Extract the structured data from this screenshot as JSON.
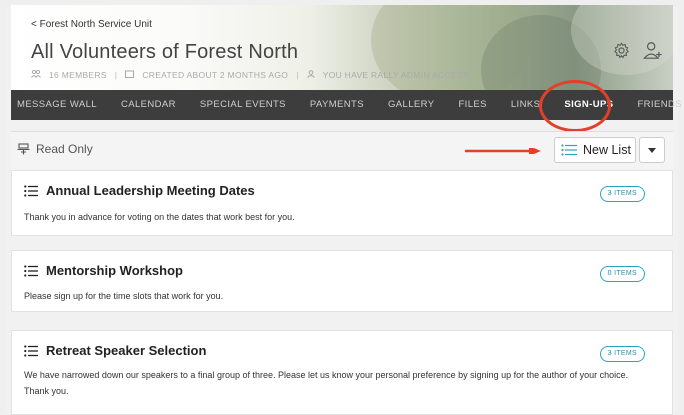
{
  "header": {
    "breadcrumb": "< Forest North Service Unit",
    "title": "All Volunteers of Forest North",
    "meta": {
      "members": "16 MEMBERS",
      "created": "CREATED ABOUT 2 MONTHS AGO",
      "access": "YOU HAVE RALLY ADMIN ACCESS"
    }
  },
  "nav": {
    "tabs": [
      {
        "label": "MESSAGE WALL"
      },
      {
        "label": "CALENDAR"
      },
      {
        "label": "SPECIAL EVENTS"
      },
      {
        "label": "PAYMENTS"
      },
      {
        "label": "GALLERY"
      },
      {
        "label": "FILES"
      },
      {
        "label": "LINKS"
      },
      {
        "label": "SIGN-UPS"
      },
      {
        "label": "FRIENDS"
      }
    ],
    "active": "SIGN-UPS"
  },
  "toolbar": {
    "readonly_label": "Read Only",
    "new_list_label": "New List"
  },
  "lists": [
    {
      "title": "Annual Leadership Meeting Dates",
      "badge": "3 ITEMS",
      "description": "Thank you in advance for voting on the dates that work best for you."
    },
    {
      "title": "Mentorship Workshop",
      "badge": "0 ITEMS",
      "description": "Please sign up for the time slots that work for you."
    },
    {
      "title": "Retreat Speaker Selection",
      "badge": "3 ITEMS",
      "description": "We have narrowed down our speakers to a final group of three. Please let us know your personal preference by signing up for the author of your choice. Thank you."
    }
  ],
  "colors": {
    "accent": "#2aa3c1",
    "nav_bg": "#3d3d3d",
    "annotation": "#e3402a"
  },
  "icons": [
    "gear-icon",
    "add-user-icon",
    "members-icon",
    "calendar-icon",
    "admin-icon",
    "read-only-icon",
    "list-icon",
    "chevron-down-icon"
  ]
}
